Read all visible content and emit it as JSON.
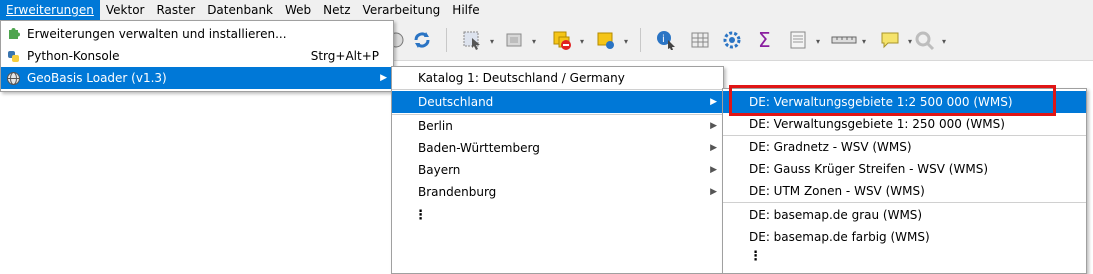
{
  "menubar": {
    "items": [
      {
        "id": "extensions",
        "label": "Erweiterungen",
        "active": true
      },
      {
        "id": "vector",
        "label": "Vektor"
      },
      {
        "id": "raster",
        "label": "Raster"
      },
      {
        "id": "database",
        "label": "Datenbank"
      },
      {
        "id": "web",
        "label": "Web"
      },
      {
        "id": "network",
        "label": "Netz"
      },
      {
        "id": "processing",
        "label": "Verarbeitung"
      },
      {
        "id": "help",
        "label": "Hilfe"
      }
    ]
  },
  "toolbar": {
    "icons": [
      "refresh-icon",
      "select-icon",
      "attribute-table-icon",
      "select-features-icon",
      "deselect-icon",
      "identify-icon",
      "measure-grid-icon",
      "settings-gear-icon",
      "sum-icon",
      "table-icon",
      "ruler-icon",
      "annotation-icon",
      "search-icon"
    ]
  },
  "menu_extensions": {
    "items": [
      {
        "label": "Erweiterungen verwalten und installieren...",
        "icon": "plugin-icon"
      },
      {
        "label": "Python-Konsole",
        "shortcut": "Strg+Alt+P",
        "icon": "python-icon"
      },
      {
        "label": "GeoBasis Loader (v1.3)",
        "icon": "globe-icon",
        "highlighted": true
      }
    ]
  },
  "menu_geobasis": {
    "items": [
      {
        "label": "Katalog 1: Deutschland / Germany"
      },
      {
        "label": "Deutschland",
        "highlighted": true
      },
      {
        "label": "Berlin"
      },
      {
        "label": "Baden-Württemberg"
      },
      {
        "label": "Bayern"
      },
      {
        "label": "Brandenburg"
      }
    ],
    "ellipsis": "⋮"
  },
  "menu_deutschland": {
    "items": [
      {
        "label": "DE: Verwaltungsgebiete 1:2 500 000 (WMS)",
        "highlighted": true
      },
      {
        "label": "DE: Verwaltungsgebiete 1: 250 000 (WMS)"
      },
      {
        "label": "DE: Gradnetz - WSV (WMS)"
      },
      {
        "label": "DE: Gauss Krüger Streifen - WSV (WMS)"
      },
      {
        "label": "DE: UTM Zonen - WSV (WMS)"
      },
      {
        "label": "DE: basemap.de grau (WMS)"
      },
      {
        "label": "DE: basemap.de farbig (WMS)"
      }
    ],
    "ellipsis": "⋮"
  },
  "colors": {
    "highlight": "#0078d7",
    "annotation_box": "#e01515",
    "menu_bg": "#ffffff",
    "bar_bg": "#f0f0f0"
  }
}
